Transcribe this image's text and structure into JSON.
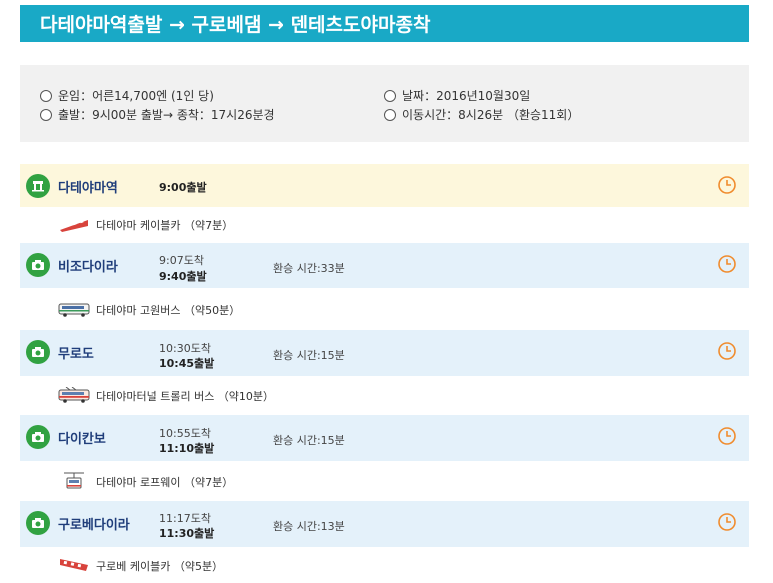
{
  "header": {
    "title": "다테야마역출발 → 구로베댐 → 덴테츠도야마종착"
  },
  "info": {
    "fare": "운임：어른14,700엔 (1인 당)",
    "date": "날짜：2016년10월30일",
    "times": "출발：9시00분 출발→ 종착：17시26분경",
    "duration": "이동시간：8시26분 （환승11회）"
  },
  "stations": [
    {
      "name": "다테야마역",
      "arrive": "",
      "depart": "9:00출발",
      "transfer": ""
    },
    {
      "name": "비조다이라",
      "arrive": "9:07도착",
      "depart": "9:40출발",
      "transfer": "환승 시간:33분"
    },
    {
      "name": "무로도",
      "arrive": "10:30도착",
      "depart": "10:45출발",
      "transfer": "환승 시간:15분"
    },
    {
      "name": "다이칸보",
      "arrive": "10:55도착",
      "depart": "11:10출발",
      "transfer": "환승 시간:15분"
    },
    {
      "name": "구로베다이라",
      "arrive": "11:17도착",
      "depart": "11:30출발",
      "transfer": "환승 시간:13분"
    }
  ],
  "transports": [
    {
      "icon": "cable-car-icon",
      "label": "다테야마 케이블카 （약7분）"
    },
    {
      "icon": "bus-icon",
      "label": "다테야마 고원버스 （약50분）"
    },
    {
      "icon": "trolley-bus-icon",
      "label": "다테야마터널 트롤리 버스 （약10분）"
    },
    {
      "icon": "ropeway-icon",
      "label": "다테야마 로프웨이 （약7분）"
    },
    {
      "icon": "cable-car-icon",
      "label": "구로베 케이블카 （약5분）"
    }
  ],
  "colors": {
    "title_bar": "#19a9c6",
    "route_line": "#f2d51a",
    "station_icon": "#31a242",
    "station_name": "#1f3d7a",
    "clock": "#f08c2e",
    "first_row_bg": "#fdf7dc",
    "station_row_bg": "#e4f1fa"
  }
}
